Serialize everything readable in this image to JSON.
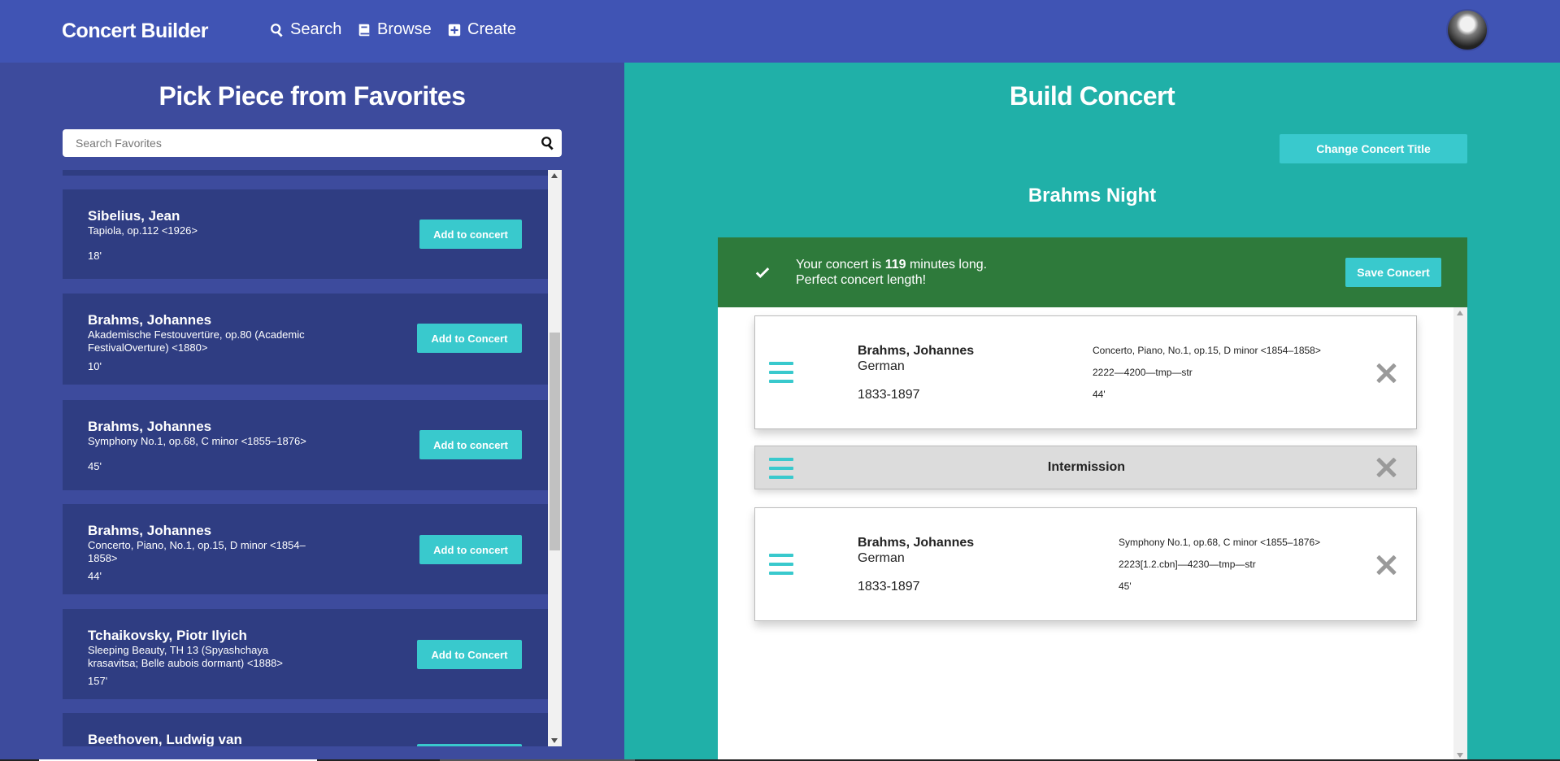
{
  "header": {
    "brand": "Concert Builder",
    "nav": [
      {
        "label": "Search",
        "icon": "search-icon"
      },
      {
        "label": "Browse",
        "icon": "book-icon"
      },
      {
        "label": "Create",
        "icon": "plus-square-icon"
      }
    ]
  },
  "favorites": {
    "title": "Pick Piece from Favorites",
    "search_placeholder": "Search Favorites",
    "items": [
      {
        "composer": "Sibelius, Jean",
        "title": "Tapiola, op.112 <1926>",
        "duration": "18'",
        "button": "Add to concert"
      },
      {
        "composer": "Brahms, Johannes",
        "title": "Akademische Festouvertüre, op.80 (Academic FestivalOverture) <1880>",
        "duration": "10'",
        "button": "Add to Concert"
      },
      {
        "composer": "Brahms, Johannes",
        "title": "Symphony No.1, op.68, C minor <1855–1876>",
        "duration": "45'",
        "button": "Add to concert"
      },
      {
        "composer": "Brahms, Johannes",
        "title": "Concerto, Piano, No.1, op.15, D minor <1854–1858>",
        "duration": "44'",
        "button": "Add to concert"
      },
      {
        "composer": "Tchaikovsky, Piotr Ilyich",
        "title": "Sleeping Beauty, TH 13 (Spyashchaya krasavitsa; Belle aubois dormant) <1888>",
        "duration": "157'",
        "button": "Add to Concert"
      },
      {
        "composer": "Beethoven, Ludwig van",
        "title": "",
        "duration": "",
        "button": ""
      }
    ]
  },
  "build": {
    "title": "Build Concert",
    "change_title_button": "Change Concert Title",
    "concert_name": "Brahms Night",
    "status": {
      "prefix": "Your concert is ",
      "minutes": "119",
      "suffix": " minutes long.",
      "note": "Perfect concert length!",
      "save_button": "Save Concert"
    },
    "program": [
      {
        "composer": "Brahms, Johannes",
        "nationality": "German",
        "lifespan": "1833-1897",
        "work": "Concerto, Piano, No.1, op.15, D minor <1854–1858>",
        "instrumentation": "2222—4200—tmp—str",
        "duration": "44'"
      },
      {
        "intermission": "Intermission"
      },
      {
        "composer": "Brahms, Johannes",
        "nationality": "German",
        "lifespan": "1833-1897",
        "work": "Symphony No.1, op.68, C minor <1855–1876>",
        "instrumentation": "2223[1.2.cbn]—4230—tmp—str",
        "duration": "45'"
      }
    ]
  },
  "colors": {
    "nav_bg": "#4054b4",
    "left_bg": "#3d4b9d",
    "card_bg": "#2f3d82",
    "right_bg": "#20b0a8",
    "accent": "#39c9cd",
    "status_bg": "#2e7a3b"
  }
}
